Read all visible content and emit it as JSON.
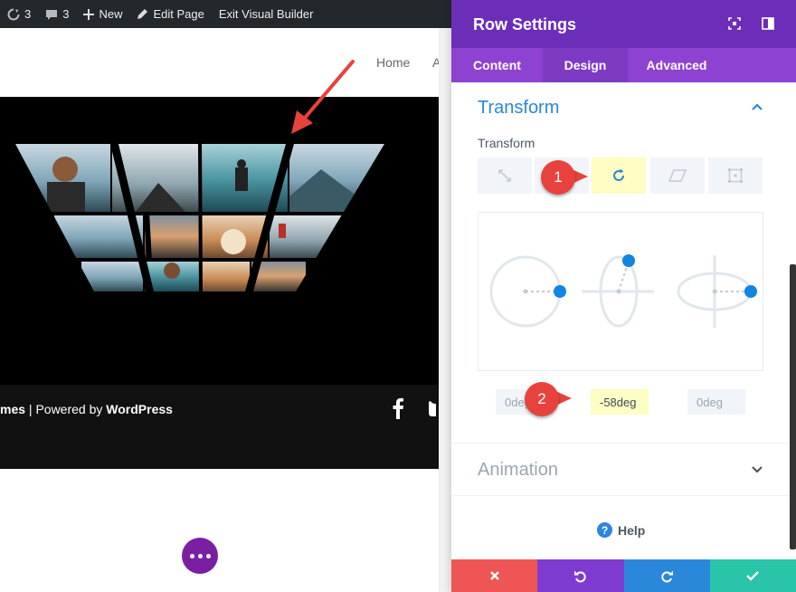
{
  "admin_bar": {
    "updates_count": "3",
    "comments_count": "3",
    "new_label": "New",
    "edit_page_label": "Edit Page",
    "exit_vb_label": "Exit Visual Builder"
  },
  "site_nav": {
    "home_label": "Home",
    "clipped_item": "A"
  },
  "footer": {
    "credit_prefix": "mes",
    "credit_separator": " | Powered by ",
    "credit_brand": "WordPress"
  },
  "panel": {
    "title": "Row Settings",
    "tabs": [
      {
        "label": "Content",
        "active": false
      },
      {
        "label": "Design",
        "active": true
      },
      {
        "label": "Advanced",
        "active": false
      }
    ],
    "transform": {
      "section_title": "Transform",
      "field_label": "Transform",
      "selected_tool": "rotate-icon",
      "rotate_values": {
        "x": "0deg",
        "y": "-58deg",
        "z": "0deg"
      }
    },
    "animation": {
      "section_title": "Animation"
    },
    "help_label": "Help"
  },
  "callouts": {
    "first": "1",
    "second": "2"
  },
  "colors": {
    "panel_header": "#6c2eb9",
    "tabs_bg": "#8e42d1",
    "accent_blue": "#2b87da",
    "highlight_yellow": "#fdfdc4",
    "callout_red": "#e8423d",
    "btn_cancel": "#ef5555",
    "btn_undo": "#7e3bd0",
    "btn_redo": "#2b87da",
    "btn_save": "#29c4a9",
    "builder_dots": "#7b1fa2"
  }
}
